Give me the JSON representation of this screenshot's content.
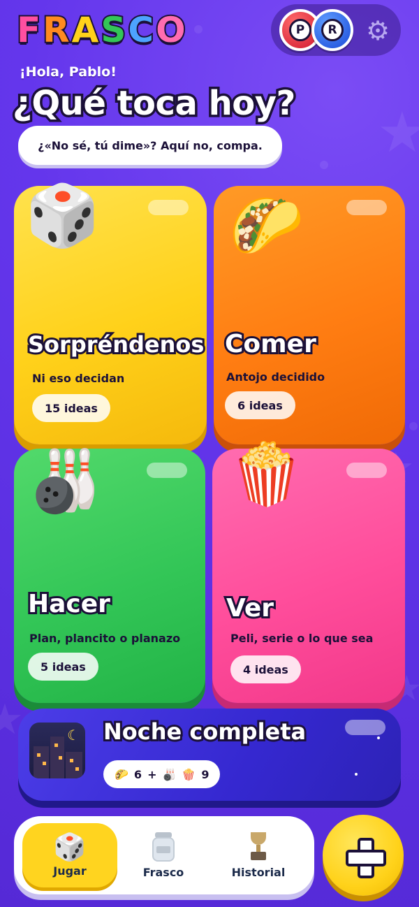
{
  "header": {
    "logo_letters": [
      {
        "char": "F",
        "color": "#ff4fa0"
      },
      {
        "char": "R",
        "color": "#ff8a1f"
      },
      {
        "char": "A",
        "color": "#ffd21a"
      },
      {
        "char": "S",
        "color": "#33c657"
      },
      {
        "char": "C",
        "color": "#4da3ff"
      },
      {
        "char": "O",
        "color": "#ff6cb0"
      }
    ],
    "avatars": [
      "P",
      "R"
    ],
    "settings_icon": "gear-icon"
  },
  "greeting": "¡Hola, Pablo!",
  "title": "¿Qué toca hoy?",
  "subtitle": "¿«No sé, tú dime»? Aquí no, compa.",
  "categories": [
    {
      "name": "Sorpréndenos",
      "description": "Ni eso decidan",
      "count": "15 ideas",
      "icon": "dice-icon",
      "color": "#ffd11a"
    },
    {
      "name": "Comer",
      "description": "Antojo decidido",
      "count": "6 ideas",
      "icon": "taco-icon",
      "color": "#ff7d12"
    },
    {
      "name": "Hacer",
      "description": "Plan, plancito o planazo",
      "count": "5 ideas",
      "icon": "bowling-icon",
      "color": "#33c657"
    },
    {
      "name": "Ver",
      "description": "Peli, serie o lo que sea",
      "count": "4 ideas",
      "icon": "popcorn-icon",
      "color": "#ff4d9b"
    }
  ],
  "night": {
    "title": "Noche completa",
    "combo_count": "9",
    "combo_first": "6",
    "combo_plus": "+",
    "icon": "night-city-icon"
  },
  "bottom_nav": [
    {
      "label": "Jugar",
      "icon": "dice-icon",
      "active": true
    },
    {
      "label": "Frasco",
      "icon": "jar-icon",
      "active": false
    },
    {
      "label": "Historial",
      "icon": "trophy-icon",
      "active": false
    }
  ],
  "fab_icon": "plus-icon"
}
